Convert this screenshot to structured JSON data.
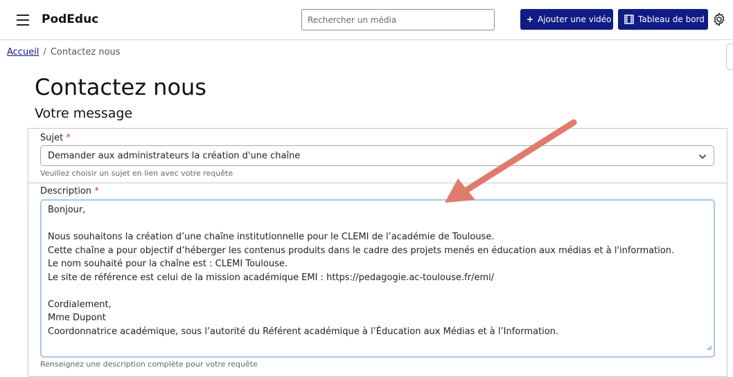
{
  "header": {
    "brand": "PodEduc",
    "search_placeholder": "Rechercher un média",
    "add_video_label": "Ajouter une vidéo",
    "dashboard_label": "Tableau de bord"
  },
  "breadcrumb": {
    "home": "Accueil",
    "separator": "/",
    "current": "Contactez nous"
  },
  "page": {
    "title": "Contactez nous",
    "section": "Votre message"
  },
  "form": {
    "subject": {
      "label": "Sujet",
      "required_mark": "*",
      "value": "Demander aux administrateurs la création d'une chaîne",
      "help": "Veuillez choisir un sujet en lien avec votre requête"
    },
    "description": {
      "label": "Description",
      "required_mark": "*",
      "lines": [
        "Bonjour,",
        "",
        "Nous souhaitons la création d’une chaîne institutionnelle pour le CLEMI de l’académie de Toulouse.",
        "Cette chaîne a pour objectif d’héberger les contenus produits dans le cadre des projets menés en éducation aux médias et à l'information.",
        "Le nom souhaité pour la chaîne est : CLEMI Toulouse.",
        "Le site de référence est celui de la mission académique EMI : https://pedagogie.ac-toulouse.fr/emi/",
        "",
        "Cordialement,",
        "Mme Dupont",
        "Coordonnatrice académique, sous l’autorité du Référent académique à l’Éducation aux Médias et à l’Information."
      ],
      "help": "Renseignez une description complète pour votre requête"
    }
  },
  "colors": {
    "primary": "#0f1c86",
    "required": "#d0312d",
    "annotation_arrow": "#e07a6a",
    "focus_border": "#a9c6ee"
  },
  "icons": {
    "menu": "hamburger-icon",
    "add": "plus-icon",
    "dashboard": "film-icon",
    "settings": "gear-icon",
    "select": "chevron-down-icon",
    "annotation": "arrow-annotation"
  }
}
